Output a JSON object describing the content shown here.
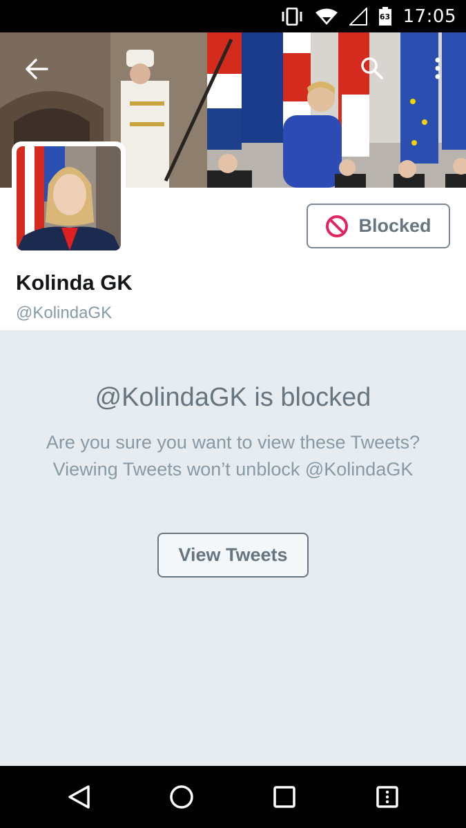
{
  "status_bar": {
    "time": "17:05",
    "battery": "63",
    "icons": [
      "vibrate-icon",
      "wifi-icon",
      "cell-signal-icon",
      "battery-icon"
    ]
  },
  "header": {
    "back_icon": "back-arrow-icon",
    "search_icon": "search-icon",
    "more_icon": "more-vert-icon"
  },
  "profile": {
    "name": "Kolinda GK",
    "handle": "@KolindaGK",
    "blocked_button_label": "Blocked",
    "blocked_icon": "block-icon"
  },
  "blocked_notice": {
    "title": "@KolindaGK is blocked",
    "description": "Are you sure you want to view these Tweets? Viewing Tweets won’t unblock @KolindaGK",
    "view_button_label": "View Tweets"
  },
  "nav_bar": {
    "icons": [
      "nav-back-icon",
      "nav-home-icon",
      "nav-recents-icon",
      "nav-menu-icon"
    ]
  },
  "colors": {
    "blocked_red": "#e0245e",
    "text_gray": "#66757f",
    "light_gray": "#8899a6",
    "background": "#e6ecf0"
  }
}
